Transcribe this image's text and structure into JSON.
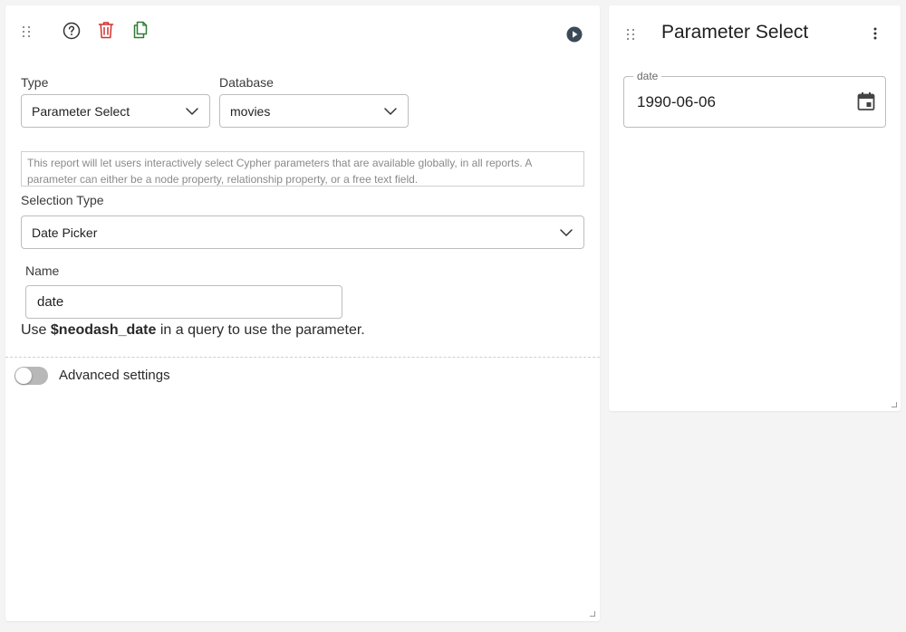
{
  "settings_card": {
    "type": {
      "label": "Type",
      "value": "Parameter Select"
    },
    "database": {
      "label": "Database",
      "value": "movies"
    },
    "description": "This report will let users interactively select Cypher parameters that are available globally, in all reports. A parameter can either be a node property, relationship property, or a free text field.",
    "selection_type": {
      "label": "Selection Type",
      "value": "Date Picker"
    },
    "name": {
      "label": "Name",
      "value": "date"
    },
    "hint": {
      "prefix": "Use ",
      "param": "$neodash_date",
      "suffix": " in a query to use the parameter."
    },
    "advanced": {
      "label": "Advanced settings",
      "enabled": false
    },
    "icons": [
      "drag-handle-icon",
      "help-icon",
      "delete-icon",
      "copy-icon",
      "run-icon"
    ],
    "colors": {
      "delete": "#d32f2f",
      "copy": "#2e7d32",
      "run": "#3c4a57"
    }
  },
  "report_card": {
    "title": "Parameter Select",
    "date_field": {
      "label": "date",
      "value": "1990-06-06"
    },
    "icons": [
      "drag-handle-icon",
      "more-vert-icon",
      "calendar-icon"
    ]
  }
}
